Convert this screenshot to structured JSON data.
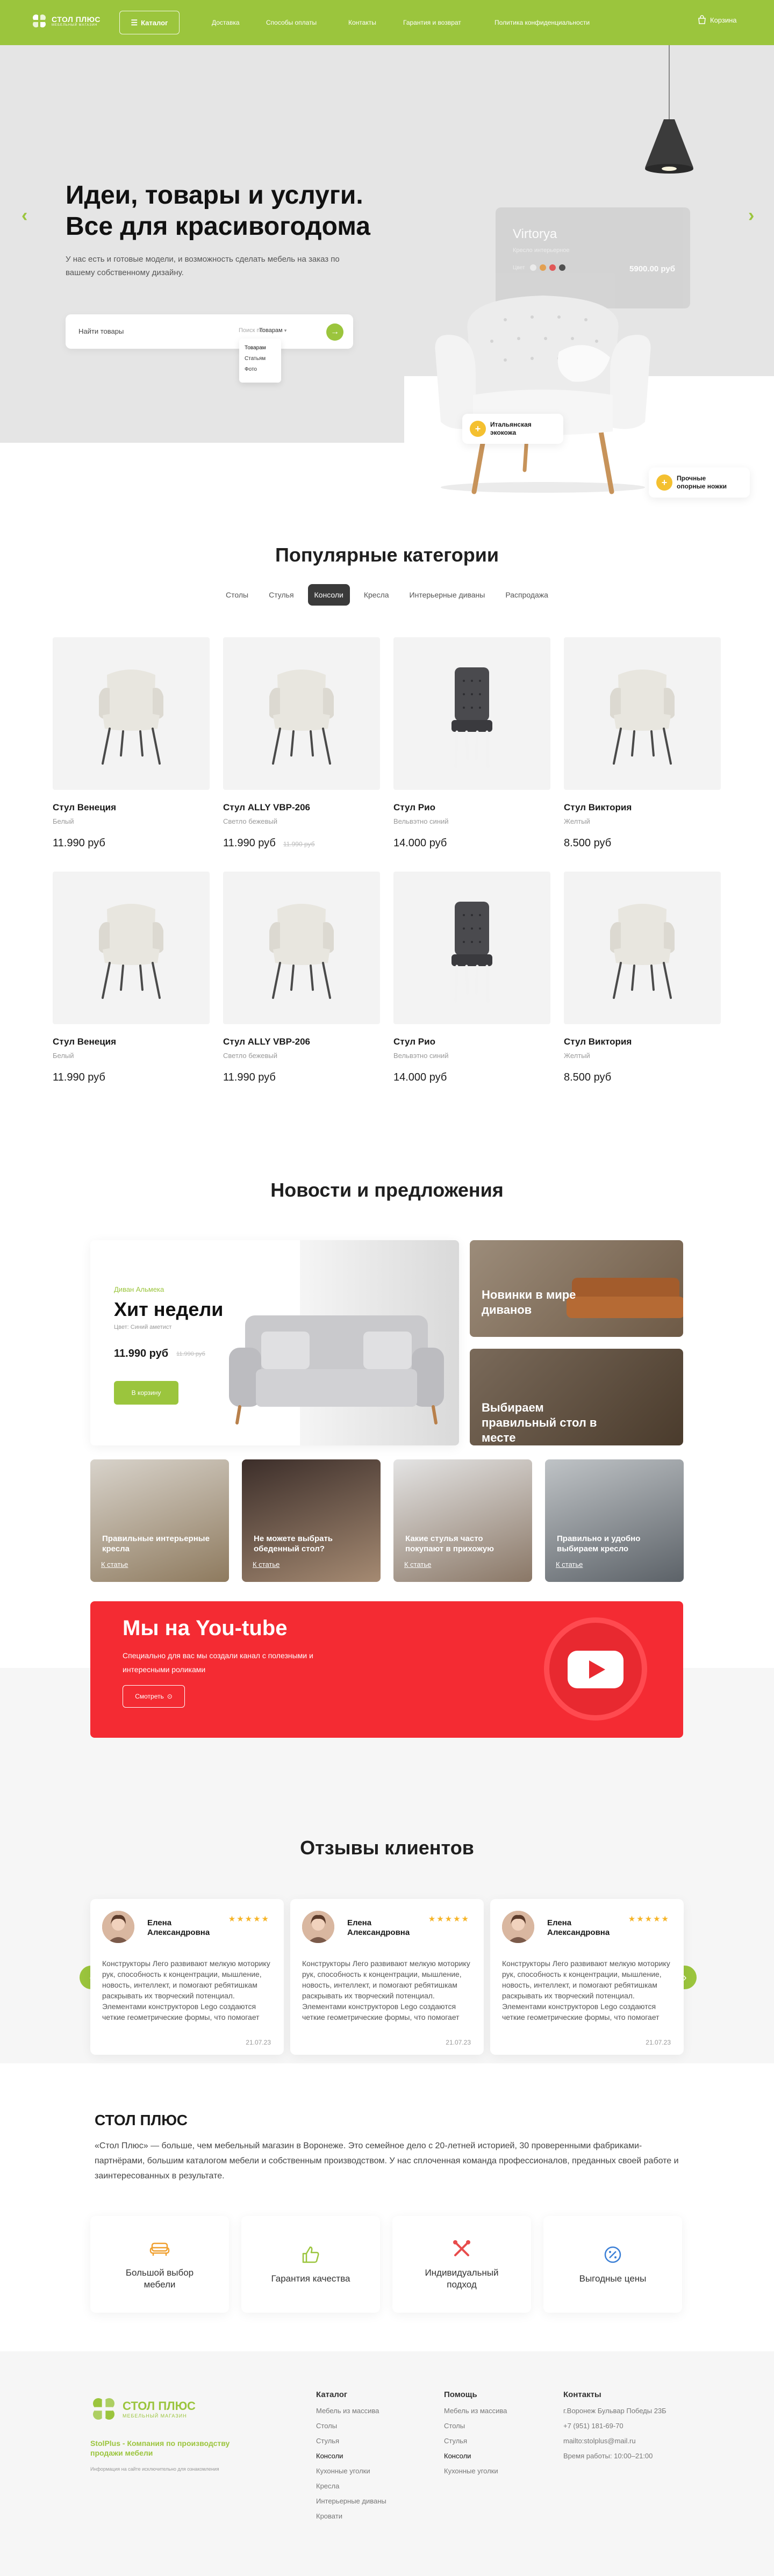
{
  "colors": {
    "accent": "#9bc53d",
    "yt_red": "#f42b33",
    "star": "#f6b426"
  },
  "header": {
    "logo_main": "СТОЛ ПЛЮС",
    "logo_sub": "МЕБЕЛЬНЫЙ МАГАЗИН",
    "catalog_label": "Каталог",
    "nav": [
      "Доставка",
      "Способы оплаты",
      "Контакты",
      "Гарантия и возврат",
      "Политика конфиденциальности"
    ],
    "cart_label": "Корзина"
  },
  "hero": {
    "title_line1": "Идеи, товары и услуги.",
    "title_line2": "Все для красивогодома",
    "subtitle": "У нас есть и готовые модели, и возможность сделать мебель на заказ по вашему собственному дизайну.",
    "search_placeholder": "Найти товары",
    "search_scope_label": "Поиск по:",
    "search_scope_value": "Товарам",
    "dropdown": [
      "Товарам",
      "Статьям",
      "Фото"
    ],
    "product_name": "Virtorya",
    "product_desc": "Кресло интерьерное",
    "product_color_label": "Цвет",
    "product_price": "5900.00 руб",
    "feature1": "Итальянская экокожа",
    "feature2": "Прочные опорные ножки"
  },
  "categories": {
    "title": "Популярные категории",
    "tabs": [
      "Столы",
      "Стулья",
      "Консоли",
      "Кресла",
      "Интерьерные диваны",
      "Распродажа"
    ],
    "active_tab": "Консоли",
    "products": [
      {
        "name": "Стул Венеция",
        "color": "Белый",
        "price": "11.990 руб",
        "old": "",
        "style": "white"
      },
      {
        "name": "Стул ALLY VBP-206",
        "color": "Светло бежевый",
        "price": "11.990 руб",
        "old": "11.990 руб",
        "style": "white"
      },
      {
        "name": "Стул Рио",
        "color": "Вельвэтно синий",
        "price": "14.000 руб",
        "old": "",
        "style": "dark"
      },
      {
        "name": "Стул Виктория",
        "color": "Желтый",
        "price": "8.500 руб",
        "old": "",
        "style": "white"
      },
      {
        "name": "Стул Венеция",
        "color": "Белый",
        "price": "11.990 руб",
        "old": "",
        "style": "white"
      },
      {
        "name": "Стул ALLY VBP-206",
        "color": "Светло бежевый",
        "price": "11.990 руб",
        "old": "",
        "style": "white"
      },
      {
        "name": "Стул Рио",
        "color": "Вельвэтно синий",
        "price": "14.000 руб",
        "old": "",
        "style": "dark"
      },
      {
        "name": "Стул Виктория",
        "color": "Желтый",
        "price": "8.500 руб",
        "old": "",
        "style": "white"
      }
    ]
  },
  "news": {
    "title": "Новости и предложения",
    "hit_brand": "Диван Альмека",
    "hit_title": "Хит недели",
    "hit_color": "Цвет: Синий аметист",
    "hit_price": "11.990 руб",
    "hit_old": "11.990 руб",
    "hit_btn": "В корзину",
    "tile_new": "Новинки в мире диванов",
    "tile_choose": "Выбираем правильный стол в месте",
    "articles": [
      {
        "title": "Правильные интерьерные кресла",
        "link": "К статье"
      },
      {
        "title": "Не можете выбрать обеденный стол?",
        "link": "К статье"
      },
      {
        "title": "Какие стулья часто покупают в прихожую",
        "link": "К статье"
      },
      {
        "title": "Правильно и удобно выбираем кресло",
        "link": "К статье"
      }
    ],
    "yt_title": "Мы на You-tube",
    "yt_text": "Специально для вас мы создали канал с полезными и интересными роликами",
    "yt_btn": "Смотреть"
  },
  "reviews": {
    "title": "Отзывы клиентов",
    "items": [
      {
        "name": "Елена Александровна",
        "stars": "★★★★★",
        "text": "Конструкторы Лего развивают мелкую моторику рук, способность к концентрации, мышление, новость, интеллект, и помогают ребятишкам раскрывать их творческий потенциал. Элементами конструкторов Lego создаются четкие геометрические формы, что помогает",
        "date": "21.07.23"
      },
      {
        "name": "Елена Александровна",
        "stars": "★★★★★",
        "text": "Конструкторы Лего развивают мелкую моторику рук, способность к концентрации, мышление, новость, интеллект, и помогают ребятишкам раскрывать их творческий потенциал. Элементами конструкторов Lego создаются четкие геометрические формы, что помогает",
        "date": "21.07.23"
      },
      {
        "name": "Елена Александровна",
        "stars": "★★★★★",
        "text": "Конструкторы Лего развивают мелкую моторику рук, способность к концентрации, мышление, новость, интеллект, и помогают ребятишкам раскрывать их творческий потенциал. Элементами конструкторов Lego создаются четкие геометрические формы, что помогает",
        "date": "21.07.23"
      }
    ]
  },
  "about": {
    "title": "СТОЛ ПЛЮС",
    "text": "«Стол Плюс» — больше, чем мебельный магазин в Воронеже. Это семейное дело с 20-летней историей, 30 проверенными фабриками-партнёрами, большим каталогом мебели и собственным производством. У нас сплоченная команда профессионалов, преданных своей работе и заинтересованных в результате.",
    "features": [
      "Большой выбор мебели",
      "Гарантия качества",
      "Индивидуальный подход",
      "Выгодные цены"
    ]
  },
  "footer": {
    "tagline": "StolPlus - Компания по производству продажи мебели",
    "note": "Информация на сайте исключительно для ознакомления",
    "catalog_title": "Каталог",
    "catalog": [
      "Мебель из массива",
      "Столы",
      "Стулья",
      "Консоли",
      "Кухонные уголки",
      "Кресла",
      "Интерьерные диваны",
      "Кровати"
    ],
    "help_title": "Помощь",
    "help": [
      "Мебель из массива",
      "Столы",
      "Стулья",
      "Консоли",
      "Кухонные уголки"
    ],
    "contacts_title": "Контакты",
    "contacts": [
      "г.Воронеж Бульвар Победы 23Б",
      "+7 (951) 181-69-70",
      "mailto:stolplus@mail.ru",
      "Время работы: 10:00–21:00"
    ]
  }
}
